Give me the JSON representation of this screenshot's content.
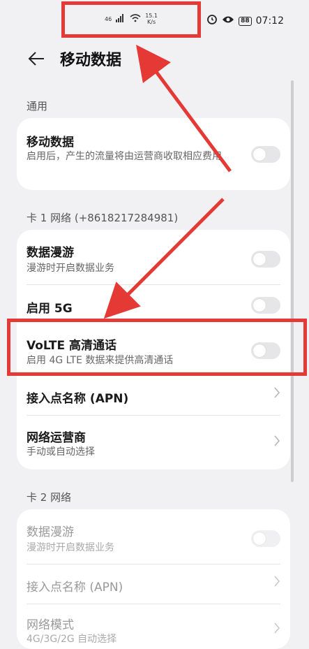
{
  "status_bar": {
    "network": "46",
    "speed_value": "15.1",
    "speed_unit": "K/s",
    "battery": "88",
    "time": "07:12"
  },
  "header": {
    "title": "移动数据"
  },
  "sections": {
    "general": {
      "label": "通用",
      "mobile_data": {
        "title": "移动数据",
        "subtitle": "启用后，产生的流量将由运营商收取相应费用",
        "toggle": "off"
      }
    },
    "sim1": {
      "label": "卡 1 网络 (+8618217284981)",
      "data_roaming": {
        "title": "数据漫游",
        "subtitle": "漫游时开启数据业务",
        "toggle": "off"
      },
      "enable_5g": {
        "title": "启用 5G",
        "toggle": "off"
      },
      "volte": {
        "title": "VoLTE 高清通话",
        "subtitle": "启用 4G LTE 数据来提供高清通话",
        "toggle": "off"
      },
      "apn": {
        "title": "接入点名称 (APN)"
      },
      "carrier": {
        "title": "网络运营商",
        "subtitle": "手动或自动选择"
      }
    },
    "sim2": {
      "label": "卡 2 网络",
      "data_roaming": {
        "title": "数据漫游",
        "subtitle": "漫游时开启数据业务",
        "toggle": "off"
      },
      "apn": {
        "title": "接入点名称 (APN)"
      },
      "network_mode": {
        "title": "网络模式",
        "subtitle": "4G/3G/2G 自动选择"
      }
    }
  },
  "colors": {
    "highlight": "#e53935",
    "background": "#f1f1f3",
    "card": "#ffffff"
  }
}
